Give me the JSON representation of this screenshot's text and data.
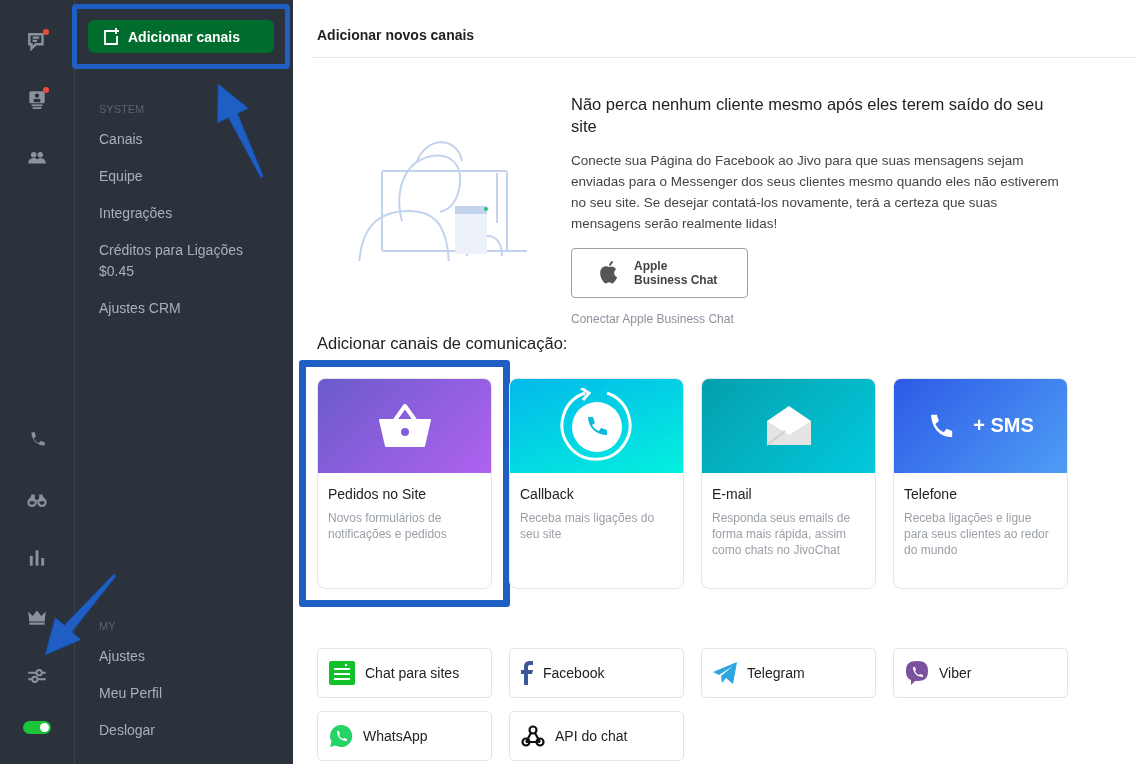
{
  "rail": {
    "top_items": [
      {
        "kind": "chat",
        "badge": true
      },
      {
        "kind": "visitor",
        "badge": true
      },
      {
        "kind": "team",
        "badge": false
      }
    ],
    "bottom_items": [
      {
        "kind": "phone"
      },
      {
        "kind": "binoculars"
      },
      {
        "kind": "stats"
      },
      {
        "kind": "crown"
      },
      {
        "kind": "settings"
      }
    ],
    "toggle": {
      "on": true
    }
  },
  "nav": {
    "add_button": {
      "label": "Adicionar canais",
      "highlighted": true
    },
    "sections": [
      {
        "title": "SYSTEM",
        "items": [
          {
            "label": "Canais"
          },
          {
            "label": "Equipe"
          },
          {
            "label": "Integrações"
          },
          {
            "label": "Créditos para Ligações",
            "sub": "$0.45"
          },
          {
            "label": "Ajustes CRM"
          }
        ]
      },
      {
        "title": "MY",
        "items": [
          {
            "label": "Ajustes"
          },
          {
            "label": "Meu Perfil"
          },
          {
            "label": "Deslogar"
          }
        ]
      }
    ]
  },
  "header": {
    "title": "Adicionar novos canais"
  },
  "promo": {
    "title": "Não perca nenhum cliente mesmo após eles terem saído do seu site",
    "text": "Conecte sua Página do Facebook ao Jivo para que suas mensagens sejam enviadas para o Messenger dos seus clientes mesmo quando eles não estiverem no seu site. Se desejar contatá-los novamente, terá a certeza que suas mensagens serão realmente lidas!",
    "button": {
      "line1": "Apple",
      "line2": "Business Chat"
    },
    "link": "Conectar Apple Business Chat"
  },
  "section_title": "Adicionar canais de comunicação:",
  "channel_cards": [
    {
      "kind": "orders",
      "title": "Pedidos no Site",
      "description": "Novos formulários de notificações e pedidos",
      "highlighted": true
    },
    {
      "kind": "callback",
      "title": "Callback",
      "description": "Receba mais ligações do seu site",
      "highlighted": false
    },
    {
      "kind": "email",
      "title": "E-mail",
      "description": "Responda seus emails de forma mais rápida, assim como chats no JivoChat",
      "highlighted": false
    },
    {
      "kind": "telephone",
      "title": "Telefone",
      "description": "Receba ligações e ligue para seus clientes ao redor do mundo",
      "banner_text": "+ SMS",
      "highlighted": false
    }
  ],
  "channels": [
    {
      "kind": "site",
      "label": "Chat para sites"
    },
    {
      "kind": "facebook",
      "label": "Facebook"
    },
    {
      "kind": "telegram",
      "label": "Telegram"
    },
    {
      "kind": "viber",
      "label": "Viber"
    },
    {
      "kind": "whatsapp",
      "label": "WhatsApp"
    },
    {
      "kind": "api",
      "label": "API do chat"
    }
  ]
}
